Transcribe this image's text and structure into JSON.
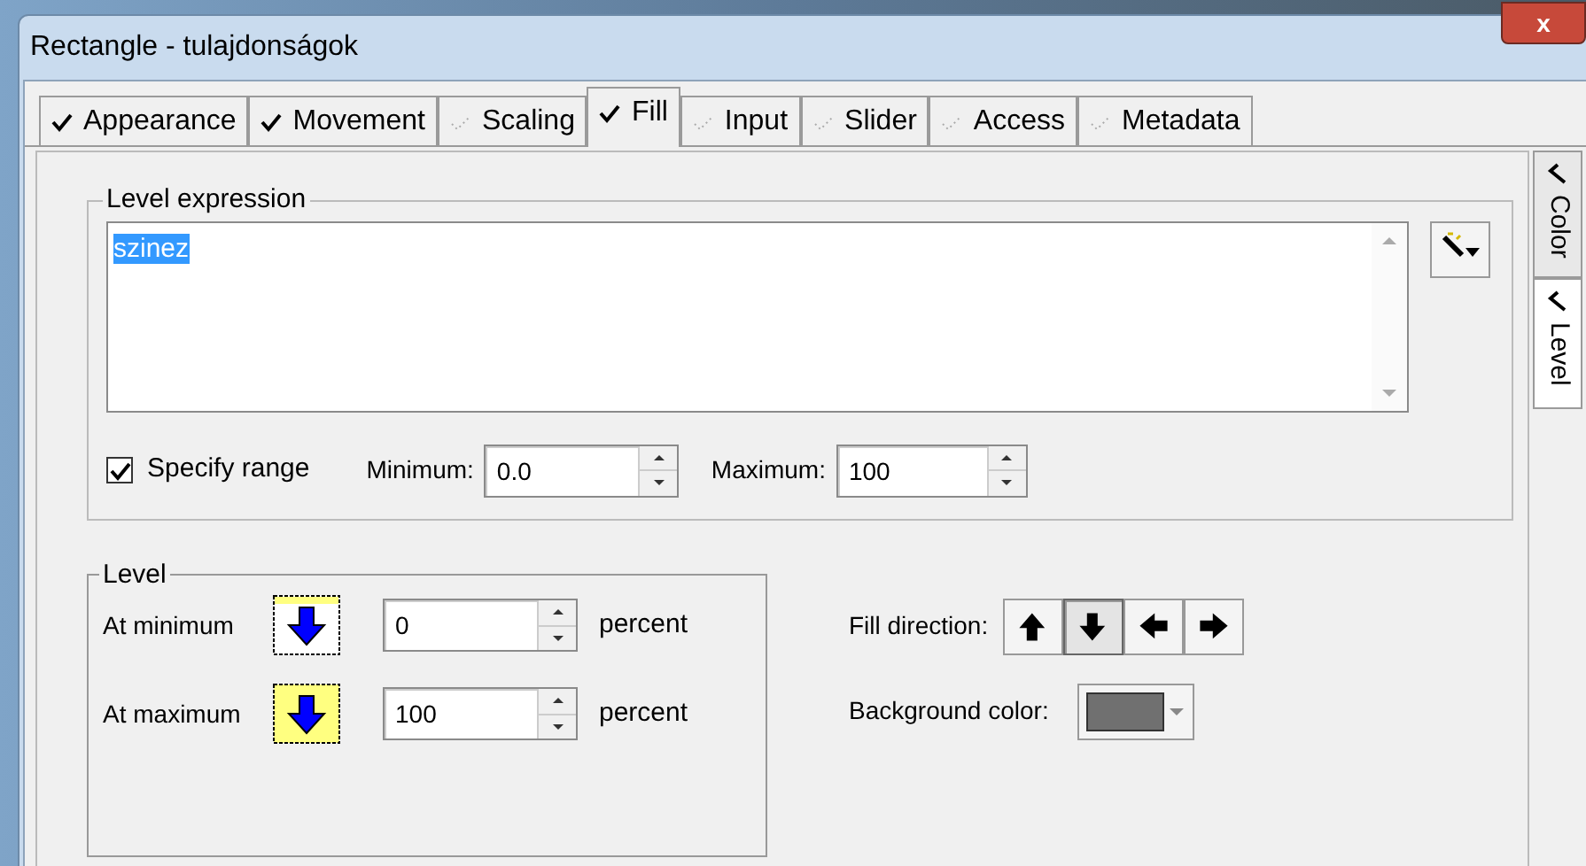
{
  "window": {
    "title": "Rectangle - tulajdonságok",
    "close": "x"
  },
  "tabs": [
    {
      "label": "Appearance",
      "checked": true,
      "selected": false
    },
    {
      "label": "Movement",
      "checked": true,
      "selected": false
    },
    {
      "label": "Scaling",
      "checked": false,
      "selected": false
    },
    {
      "label": "Fill",
      "checked": true,
      "selected": true
    },
    {
      "label": "Input",
      "checked": false,
      "selected": false
    },
    {
      "label": "Slider",
      "checked": false,
      "selected": false
    },
    {
      "label": "Access",
      "checked": false,
      "selected": false
    },
    {
      "label": "Metadata",
      "checked": false,
      "selected": false
    }
  ],
  "side_tabs": [
    {
      "label": "Color",
      "checked": true,
      "selected": false
    },
    {
      "label": "Level",
      "checked": true,
      "selected": true
    }
  ],
  "level_expression": {
    "title": "Level expression",
    "value": "szinez",
    "specify_range": {
      "label": "Specify range",
      "checked": true
    },
    "minimum": {
      "label": "Minimum:",
      "value": "0.0"
    },
    "maximum": {
      "label": "Maximum:",
      "value": "100"
    }
  },
  "level": {
    "title": "Level",
    "rows": [
      {
        "label": "At minimum",
        "kind": "minimum",
        "value": "0",
        "unit": "percent"
      },
      {
        "label": "At maximum",
        "kind": "maximum",
        "value": "100",
        "unit": "percent"
      }
    ]
  },
  "fill_direction": {
    "label": "Fill direction:",
    "buttons": [
      {
        "kind": "up",
        "selected": false
      },
      {
        "kind": "down",
        "selected": true
      },
      {
        "kind": "left",
        "selected": false
      },
      {
        "kind": "right",
        "selected": false
      }
    ]
  },
  "background_color": {
    "label": "Background color:",
    "color": "#707070"
  }
}
